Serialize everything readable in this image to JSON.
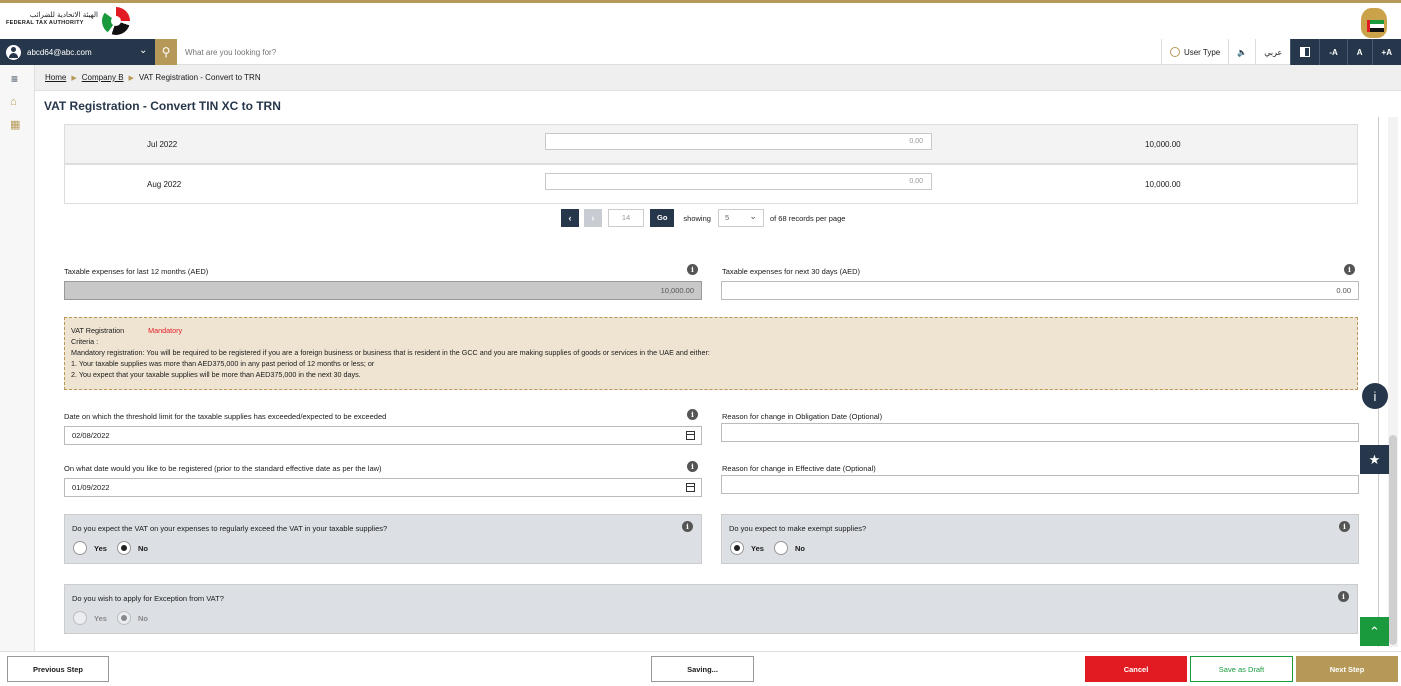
{
  "brand": {
    "arabic_name": "الهيئة الاتحادية للضرائب",
    "english_name": "FEDERAL TAX AUTHORITY"
  },
  "navbar": {
    "user_email": "abcd64@abc.com",
    "search_placeholder": "What are you looking for?",
    "user_type_label": "User Type",
    "audio_icon": "🔈",
    "language_label": "عربي",
    "font_decrease": "-A",
    "font_normal": "A",
    "font_increase": "+A"
  },
  "breadcrumb": {
    "home": "Home",
    "company": "Company B",
    "current": "VAT Registration - Convert to TRN"
  },
  "page": {
    "title": "VAT Registration - Convert TIN XC to TRN"
  },
  "monthly_rows": [
    {
      "month": "Jul 2022",
      "input_value": "0.00",
      "value": "10,000.00"
    },
    {
      "month": "Aug 2022",
      "input_value": "0.00",
      "value": "10,000.00"
    }
  ],
  "pagination": {
    "page": "14",
    "go_label": "Go",
    "showing_label": "showing",
    "per_page": "5",
    "after_label": "of 68 records per page"
  },
  "expenses": {
    "last12_label": "Taxable expenses for last 12 months (AED)",
    "last12_value": "10,000.00",
    "next30_label": "Taxable expenses for next 30 days (AED)",
    "next30_value": "0.00"
  },
  "criteria": {
    "title": "VAT Registration",
    "status": "Mandatory",
    "criteria_label": "Criteria :",
    "line1": "Mandatory registration: You will be required to be registered if you are a foreign business or business that is resident in the GCC and you are making supplies of goods or services in the UAE and either:",
    "line2": "1. Your taxable supplies was more than AED375,000 in any past period of 12 months or less; or",
    "line3": "2. You expect that your taxable supplies will be more than AED375,000 in the next 30 days."
  },
  "dates": {
    "threshold_label": "Date on which the threshold limit for the taxable supplies has exceeded/expected to be exceeded",
    "threshold_value": "02/08/2022",
    "obligation_reason_label": "Reason for change in Obligation Date (Optional)",
    "register_label": "On what date would you like to be registered (prior to the standard effective date as per the law)",
    "register_value": "01/09/2022",
    "effective_reason_label": "Reason for change in Effective date (Optional)"
  },
  "questions": {
    "q1": "Do you expect the VAT on your expenses to regularly exceed the VAT in your taxable supplies?",
    "q1_selected": "No",
    "q2": "Do you expect to make exempt supplies?",
    "q2_selected": "Yes",
    "q3": "Do you wish to apply for Exception from VAT?",
    "q3_selected": "No",
    "yes_label": "Yes",
    "no_label": "No"
  },
  "floating": {
    "info_icon": "i",
    "star_icon": "★",
    "top_icon": "⌃"
  },
  "footer": {
    "previous": "Previous Step",
    "saving": "Saving...",
    "cancel": "Cancel",
    "draft": "Save as Draft",
    "next": "Next Step"
  },
  "colors": {
    "navy": "#27374b",
    "gold": "#b69958",
    "red": "#e21b23",
    "green": "#1a9a3d"
  }
}
